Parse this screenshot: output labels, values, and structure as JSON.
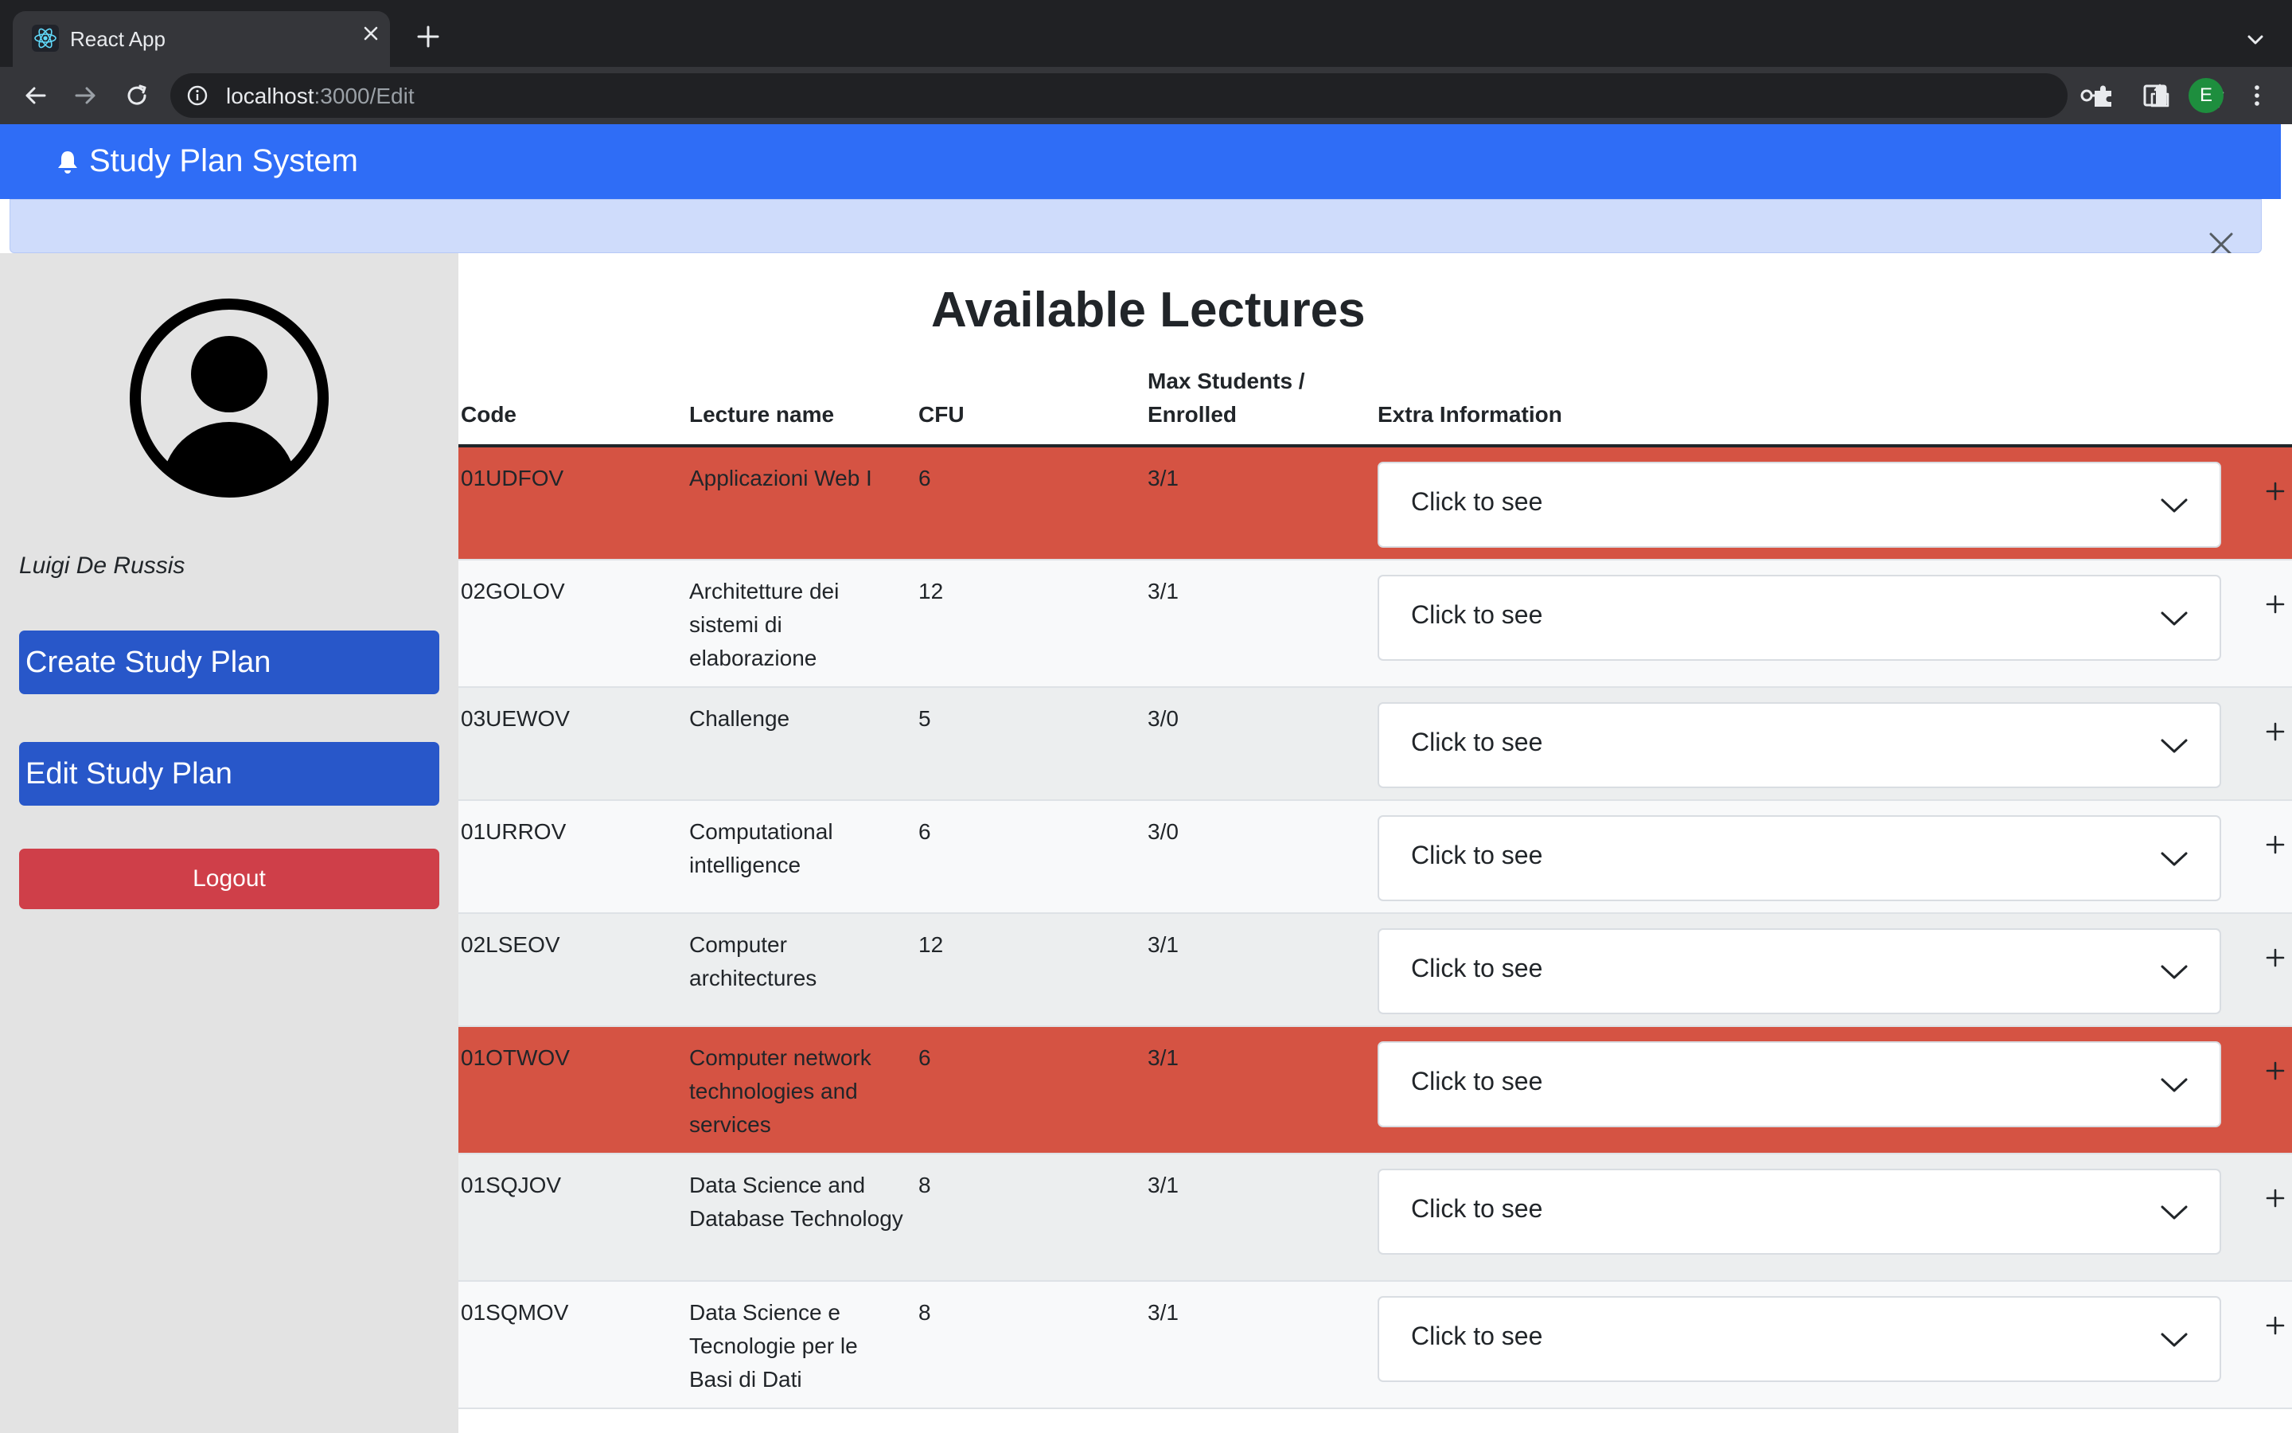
{
  "browser": {
    "tab_title": "React App",
    "url_host": "localhost",
    "url_rest": ":3000/Edit",
    "profile_initial": "E"
  },
  "navbar": {
    "brand": "Study Plan System",
    "icon": "bell-icon",
    "color": "#2f6df6"
  },
  "sidebar": {
    "user_name": "Luigi De Russis",
    "create_label": "Create Study Plan",
    "edit_label": "Edit Study Plan",
    "logout_label": "Logout"
  },
  "main": {
    "title": "Available Lectures",
    "columns": {
      "code": "Code",
      "name": "Lecture name",
      "cfu": "CFU",
      "max_line1": "Max Students /",
      "max_line2": "Enrolled",
      "extra": "Extra Information"
    },
    "dropdown_label": "Click to see",
    "rows": [
      {
        "code": "01UDFOV",
        "name": "Applicazioni Web I",
        "cfu": "6",
        "max": "3/1",
        "highlight": true
      },
      {
        "code": "02GOLOV",
        "name": "Architetture dei sistemi di elaborazione",
        "cfu": "12",
        "max": "3/1",
        "highlight": false
      },
      {
        "code": "03UEWOV",
        "name": "Challenge",
        "cfu": "5",
        "max": "3/0",
        "highlight": false
      },
      {
        "code": "01URROV",
        "name": "Computational intelligence",
        "cfu": "6",
        "max": "3/0",
        "highlight": false
      },
      {
        "code": "02LSEOV",
        "name": "Computer architectures",
        "cfu": "12",
        "max": "3/1",
        "highlight": false
      },
      {
        "code": "01OTWOV",
        "name": "Computer network technologies and services",
        "cfu": "6",
        "max": "3/1",
        "highlight": true
      },
      {
        "code": "01SQJOV",
        "name": "Data Science and Database Technology",
        "cfu": "8",
        "max": "3/1",
        "highlight": false
      },
      {
        "code": "01SQMOV",
        "name": "Data Science e Tecnologie per le Basi di Dati",
        "cfu": "8",
        "max": "3/1",
        "highlight": false
      }
    ],
    "highlight_color": "#d55343"
  }
}
